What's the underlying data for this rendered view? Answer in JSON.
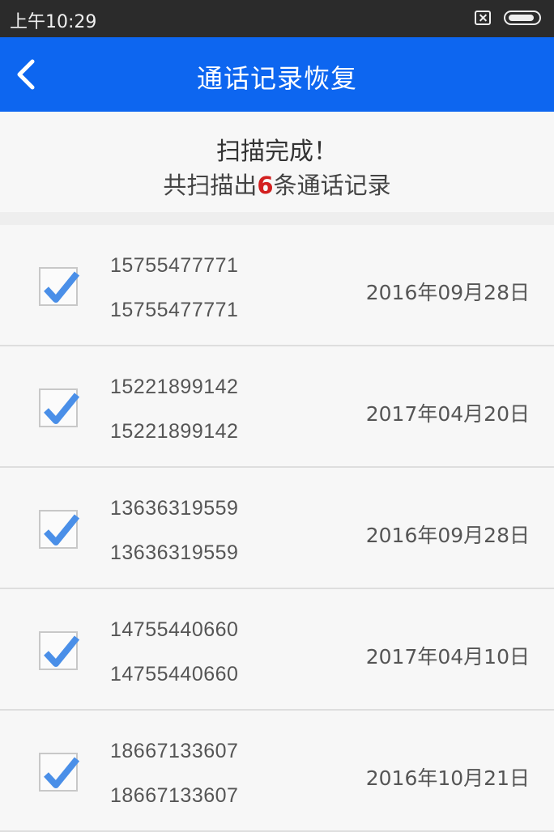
{
  "status_bar": {
    "time": "上午10:29",
    "battery_level": 0.9
  },
  "app_bar": {
    "title": "通话记录恢复"
  },
  "summary": {
    "title": "扫描完成！",
    "count_prefix": "共扫描出",
    "count": "6",
    "count_suffix": "条通话记录"
  },
  "records": [
    {
      "name": "15755477771",
      "number": "15755477771",
      "date": "2016年09月28日",
      "checked": true
    },
    {
      "name": "15221899142",
      "number": "15221899142",
      "date": "2017年04月20日",
      "checked": true
    },
    {
      "name": "13636319559",
      "number": "13636319559",
      "date": "2016年09月28日",
      "checked": true
    },
    {
      "name": "14755440660",
      "number": "14755440660",
      "date": "2017年04月10日",
      "checked": true
    },
    {
      "name": "18667133607",
      "number": "18667133607",
      "date": "2016年10月21日",
      "checked": true
    }
  ],
  "colors": {
    "accent": "#0d66f0",
    "check": "#4a8fe8",
    "count_highlight": "#d32020"
  }
}
